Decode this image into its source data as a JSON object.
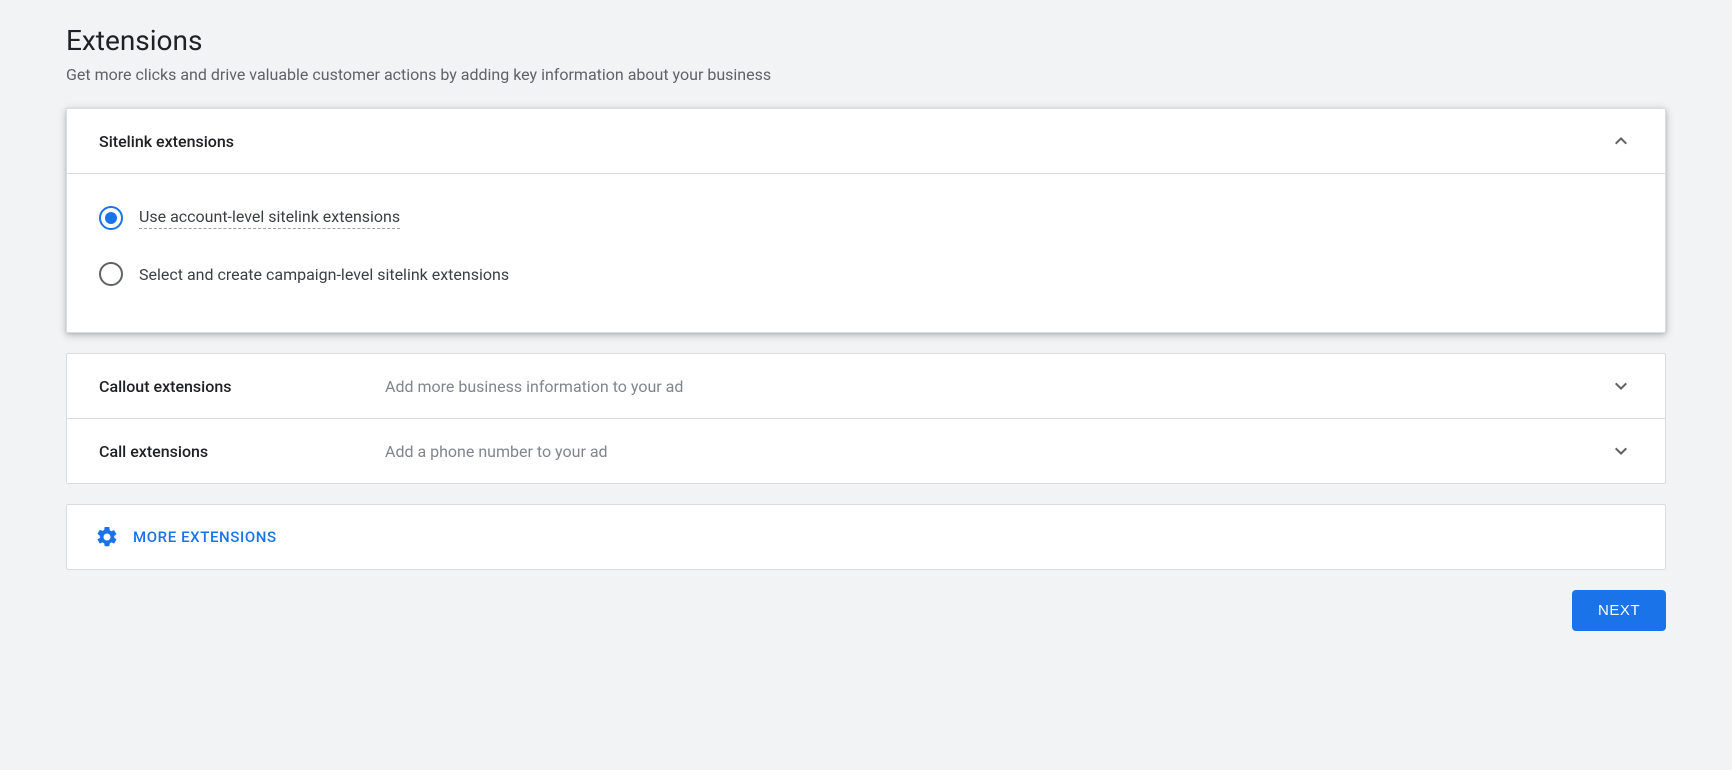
{
  "header": {
    "title": "Extensions",
    "subtitle": "Get more clicks and drive valuable customer actions by adding key information about your business"
  },
  "sitelink": {
    "title": "Sitelink extensions",
    "option1": "Use account-level sitelink extensions",
    "option2": "Select and create campaign-level sitelink extensions"
  },
  "callout": {
    "title": "Callout extensions",
    "hint": "Add more business information to your ad"
  },
  "call": {
    "title": "Call extensions",
    "hint": "Add a phone number to your ad"
  },
  "more": {
    "label": "MORE EXTENSIONS"
  },
  "footer": {
    "next": "NEXT"
  }
}
